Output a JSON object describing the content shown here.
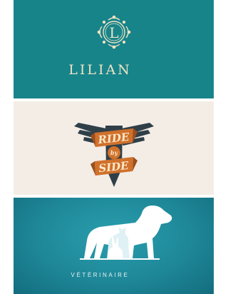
{
  "logos": [
    {
      "brand": "LILIAN",
      "monogram": "L",
      "colors": {
        "background": "#17848a",
        "ink": "#efe2c4"
      },
      "icon": "ornate-frame-monogram-icon"
    },
    {
      "banner_top": "RIDE",
      "banner_middle": "by",
      "banner_bottom": "SIDE",
      "colors": {
        "background": "#f3ede6",
        "wings": "#2f3f48",
        "banner": "#d0712c"
      },
      "icon": "winged-shield-banner-icon"
    },
    {
      "brand": "VÉTÉRINAIRE",
      "colors": {
        "background": "#1e8798",
        "silhouette": "#ffffff"
      },
      "icon": "dog-cat-rabbit-silhouette-icon"
    }
  ]
}
